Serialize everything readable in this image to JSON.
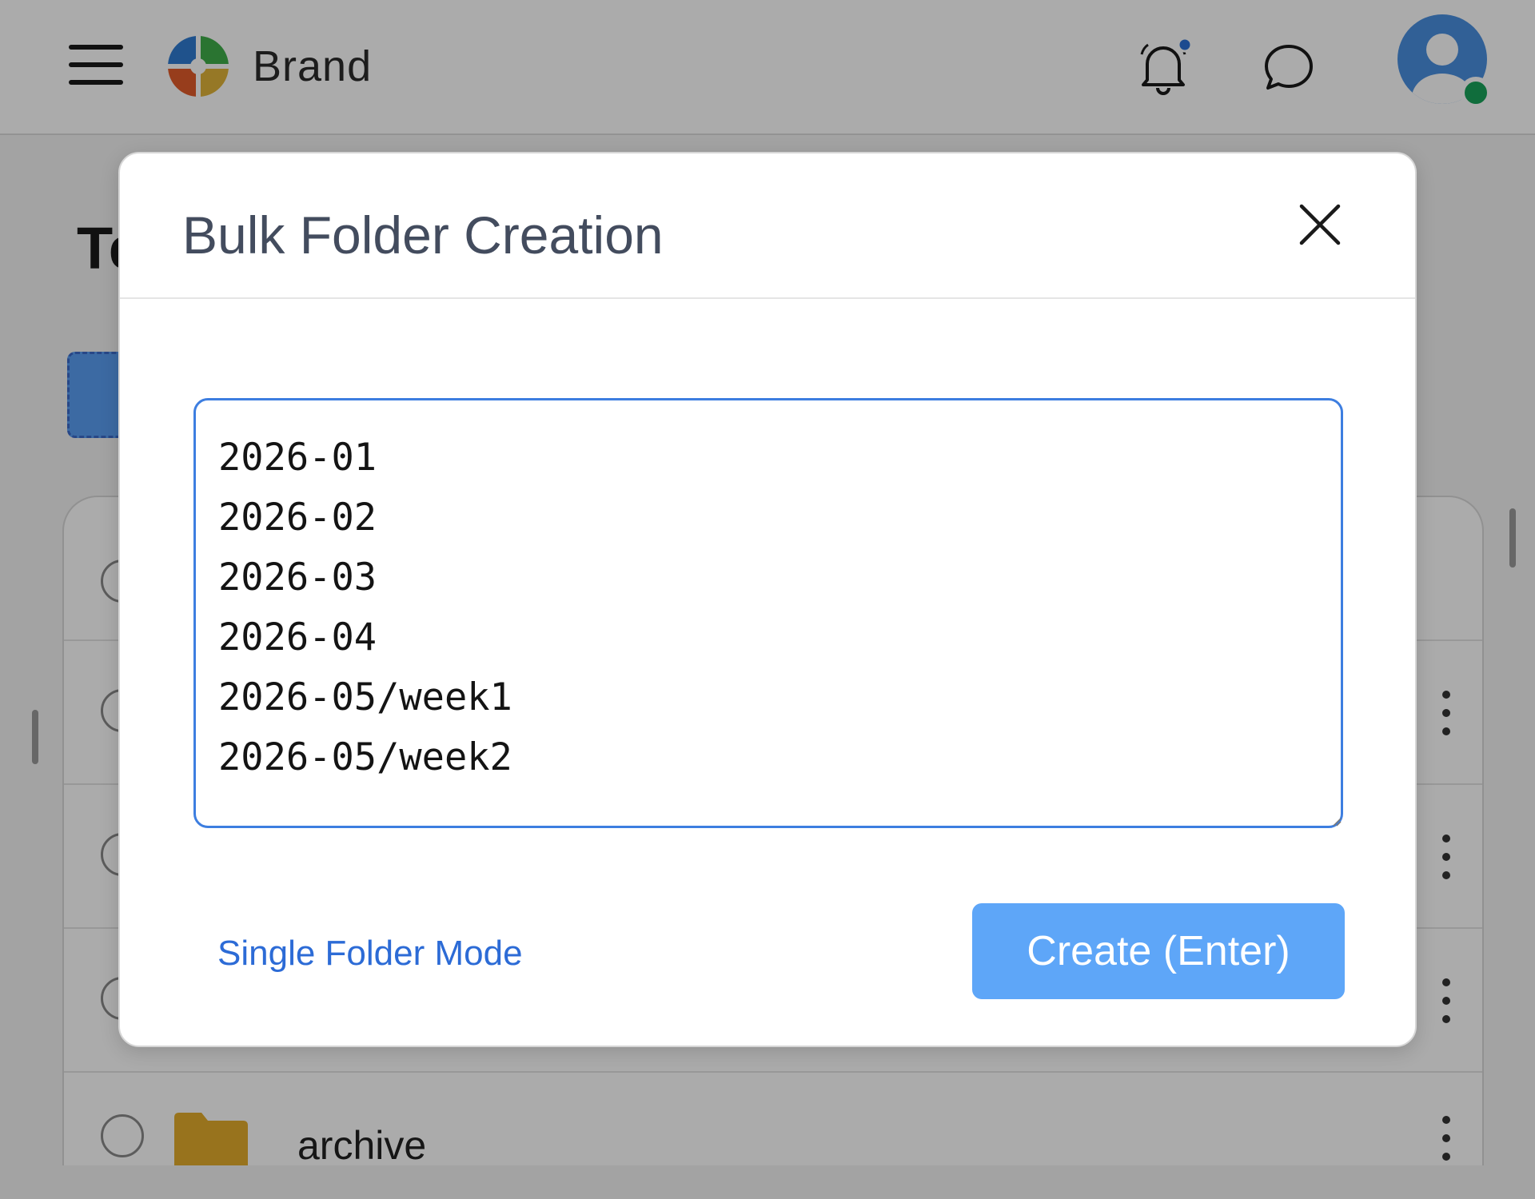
{
  "header": {
    "brand": "Brand",
    "menu_icon": "hamburger-icon",
    "notification_icon": "bell-icon",
    "chat_icon": "chat-bubble-icon",
    "avatar_icon": "user-avatar-icon",
    "status": "online"
  },
  "page": {
    "title_partial": "Te"
  },
  "list": {
    "rows": [
      {
        "name": ""
      },
      {
        "name": ""
      },
      {
        "name": ""
      },
      {
        "name": ""
      },
      {
        "name": "archive",
        "icon": "folder-icon"
      }
    ]
  },
  "modal": {
    "title": "Bulk Folder Creation",
    "close_icon": "close-icon",
    "textarea_value": "2026-01\n2026-02\n2026-03\n2026-04\n2026-05/week1\n2026-05/week2",
    "single_mode_link": "Single Folder Mode",
    "create_button": "Create (Enter)"
  },
  "colors": {
    "accent": "#3d7ee0",
    "button": "#5ea6f8",
    "link": "#2c6bd6",
    "online": "#19a35a",
    "notification_dot": "#2a6fd6",
    "folder": "#e3ac2c"
  }
}
